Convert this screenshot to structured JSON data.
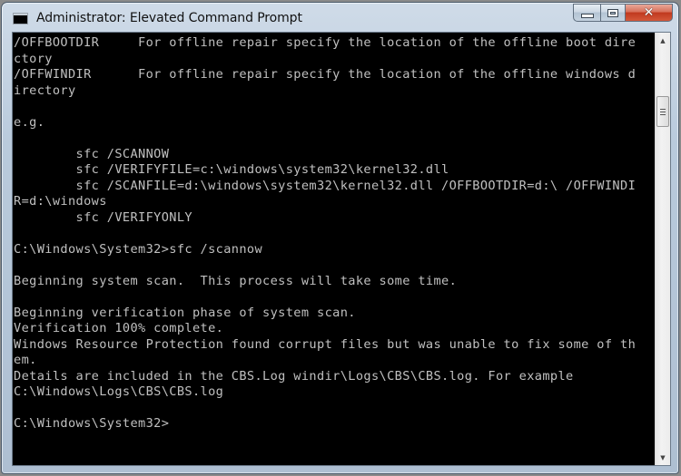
{
  "window": {
    "title": "Administrator: Elevated Command Prompt",
    "app_icon_text": "C:\\.",
    "buttons": {
      "minimize": "minimize",
      "maximize": "maximize",
      "close": "✕"
    }
  },
  "console": {
    "lines": [
      "/OFFBOOTDIR     For offline repair specify the location of the offline boot dire",
      "ctory",
      "/OFFWINDIR      For offline repair specify the location of the offline windows d",
      "irectory",
      "",
      "e.g.",
      "",
      "        sfc /SCANNOW",
      "        sfc /VERIFYFILE=c:\\windows\\system32\\kernel32.dll",
      "        sfc /SCANFILE=d:\\windows\\system32\\kernel32.dll /OFFBOOTDIR=d:\\ /OFFWINDI",
      "R=d:\\windows",
      "        sfc /VERIFYONLY",
      "",
      "C:\\Windows\\System32>sfc /scannow",
      "",
      "Beginning system scan.  This process will take some time.",
      "",
      "Beginning verification phase of system scan.",
      "Verification 100% complete.",
      "Windows Resource Protection found corrupt files but was unable to fix some of th",
      "em.",
      "Details are included in the CBS.Log windir\\Logs\\CBS\\CBS.log. For example",
      "C:\\Windows\\Logs\\CBS\\CBS.log",
      "",
      "C:\\Windows\\System32>"
    ]
  },
  "scrollbar": {
    "up_arrow": "▲",
    "down_arrow": "▼",
    "position_fraction": 0.13
  },
  "colors": {
    "console_bg": "#000000",
    "console_fg": "#c0c0c0",
    "close_button": "#c0391e"
  }
}
